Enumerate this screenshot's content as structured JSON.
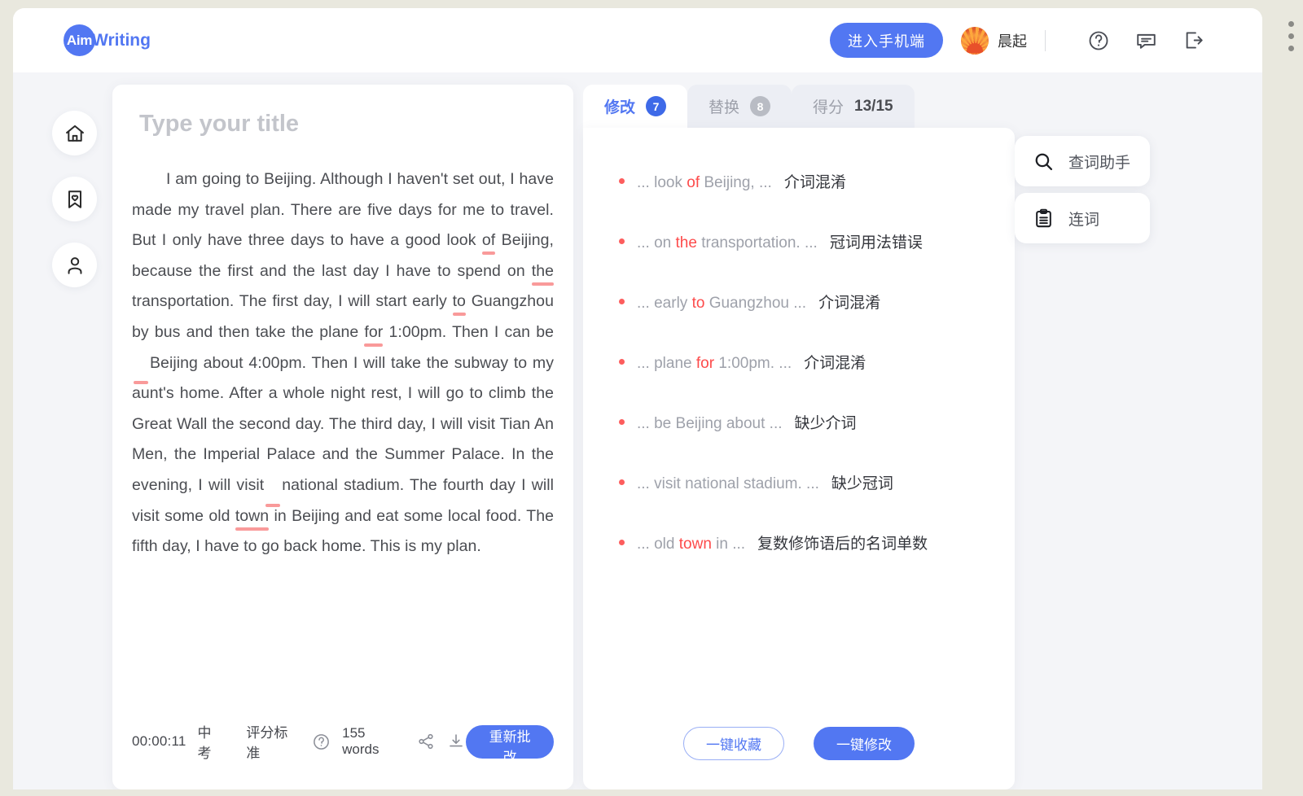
{
  "app": {
    "logo_badge": "Aim",
    "logo_word": "Writing"
  },
  "header": {
    "mobile_button": "进入手机端",
    "username": "晨起",
    "icons": [
      "help-circle-icon",
      "message-icon",
      "logout-icon"
    ]
  },
  "rail": {
    "items": [
      {
        "icon": "home-icon",
        "name": "sidebar-item-home"
      },
      {
        "icon": "bookmark-heart-icon",
        "name": "sidebar-item-favorites"
      },
      {
        "icon": "user-icon",
        "name": "sidebar-item-profile"
      }
    ]
  },
  "editor": {
    "title_placeholder": "Type your title",
    "paragraph": [
      {
        "t": "I am going to Beijing. Although I haven't set out, I have made my travel plan. There are five days for me to travel. But I only have three days to have a good look "
      },
      {
        "t": "of",
        "err": true
      },
      {
        "t": " Beijing, because the first and the last day I have to spend on "
      },
      {
        "t": "the",
        "err": true
      },
      {
        "t": " transportation. The first day, I will start early "
      },
      {
        "t": "to",
        "err": true
      },
      {
        "t": " Guangzhou by bus and then take the plane "
      },
      {
        "t": "for",
        "err": true
      },
      {
        "t": " 1:00pm. Then I can be"
      },
      {
        "t": "",
        "gap": true
      },
      {
        "t": "Beijing about 4:00pm. Then I will take the subway to my aunt's home. After a whole night rest, I will go to climb the Great Wall the second day. The third day, I will visit Tian An Men, the Imperial Palace and the Summer Palace. In the evening, I will visit"
      },
      {
        "t": "",
        "gap": true
      },
      {
        "t": "national stadium. The fourth day I will visit some old "
      },
      {
        "t": "town",
        "err": true
      },
      {
        "t": " in Beijing and eat some local food. The fifth day, I have to go back home. This is my plan."
      }
    ],
    "toolbar": {
      "time": "00:00:11",
      "level": "中考",
      "rubric": "评分标准",
      "rubric_icon": "help-circle-icon",
      "word_count": "155 words",
      "share_icon": "share-icon",
      "download_icon": "download-icon",
      "recheck_button": "重新批改"
    }
  },
  "panel": {
    "tabs": [
      {
        "label": "修改",
        "badge": "7",
        "active": true
      },
      {
        "label": "替换",
        "badge": "8",
        "active": false
      },
      {
        "label": "得分",
        "score": "13/15",
        "active": false
      }
    ],
    "suggestions": [
      {
        "pre": "... look ",
        "word": "of",
        "post": " Beijing, ...",
        "type": "介词混淆"
      },
      {
        "pre": "... on ",
        "word": "the",
        "post": " transportation. ...",
        "type": "冠词用法错误"
      },
      {
        "pre": "... early ",
        "word": "to",
        "post": " Guangzhou ...",
        "type": "介词混淆"
      },
      {
        "pre": "... plane ",
        "word": "for",
        "post": " 1:00pm. ...",
        "type": "介词混淆"
      },
      {
        "pre": "... be Beijing about ...",
        "word": "",
        "post": "",
        "type": "缺少介词"
      },
      {
        "pre": "... visit national stadium. ...",
        "word": "",
        "post": "",
        "type": "缺少冠词"
      },
      {
        "pre": "... old ",
        "word": "town",
        "post": " in ...",
        "type": "复数修饰语后的名词单数"
      }
    ],
    "actions": {
      "favorite_button": "一键收藏",
      "fix_button": "一键修改"
    }
  },
  "tools": [
    {
      "label": "查词助手",
      "icon": "search-icon"
    },
    {
      "label": "连词",
      "icon": "clipboard-icon"
    }
  ],
  "colors": {
    "brand_blue": "#5277f2",
    "error_red": "#fd4b4b",
    "underline_pink": "#f99a9a",
    "frame_beige": "#e9e8de",
    "page_bg": "#f4f5f8"
  }
}
